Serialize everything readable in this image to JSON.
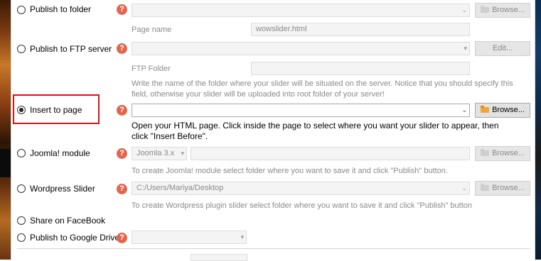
{
  "options": [
    {
      "label": "Publish to folder",
      "selected": false
    },
    {
      "label": "Publish to FTP server",
      "selected": false
    },
    {
      "label": "Insert to page",
      "selected": true
    },
    {
      "label": "Joomla! module",
      "selected": false
    },
    {
      "label": "Wordpress Slider",
      "selected": false
    },
    {
      "label": "Share on FaceBook",
      "selected": false
    },
    {
      "label": "Publish to Google Drive",
      "selected": false
    }
  ],
  "help_icon": "?",
  "publish_folder": {
    "path_value": "",
    "browse_label": "Browse..."
  },
  "page_name": {
    "label": "Page name",
    "value": "wowslider.html"
  },
  "ftp": {
    "server_value": "",
    "edit_label": "Edit...",
    "folder_label": "FTP Folder",
    "folder_value": "",
    "hint": "Write the name of the folder where your slider will be situated on the server. Notice that you should specify this field, otherwise your slider will be uploaded into root folder of your server!"
  },
  "insert_page": {
    "path_value": "",
    "browse_label": "Browse...",
    "hint": "Open your HTML page. Click inside the page to select where you want your slider to appear, then click \"Insert Before\"."
  },
  "joomla": {
    "version": "Joomla 3.x",
    "path_value": "",
    "browse_label": "Browse...",
    "hint": "To create Joomla! module select folder where you want to save it and click \"Publish\" button."
  },
  "wordpress": {
    "path_value": "C:/Users/Mariya/Desktop",
    "browse_label": "Browse...",
    "hint": "To create Wordpress plugin slider select folder where you want to save it and click \"Publish\" button"
  },
  "google_drive": {
    "value": ""
  },
  "colors": {
    "help": "#e0674e",
    "highlight": "#d41414",
    "browse_icon_active": "#f0a43a"
  },
  "icons": {
    "help": "question-mark-icon",
    "folder": "folder-icon",
    "dropdown": "chevron-down-icon"
  }
}
